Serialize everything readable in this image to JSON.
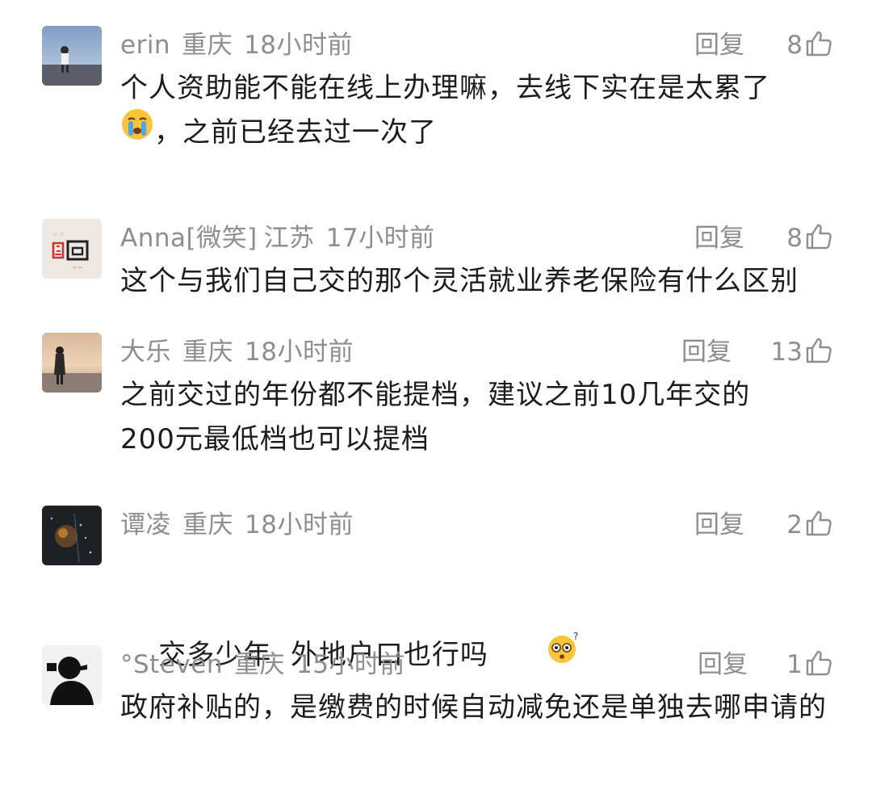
{
  "comments": [
    {
      "username": "erin",
      "location": "重庆",
      "time": "18小时前",
      "reply": "回复",
      "likes": "8",
      "text_a": "个人资助能不能在线上办理嘛，去线下实在是太累了",
      "text_b": "，之前已经去过一次了",
      "emoji": "crying-face"
    },
    {
      "username": "Anna[微笑]",
      "location": "江苏",
      "time": "17小时前",
      "reply": "回复",
      "likes": "8",
      "text": "这个与我们自己交的那个灵活就业养老保险有什么区别"
    },
    {
      "username": "大乐",
      "location": "重庆",
      "time": "18小时前",
      "reply": "回复",
      "likes": "13",
      "text_line1": "之前交过的年份都不能提档，建议之前10几年交的",
      "text_line2": "200元最低档也可以提档"
    },
    {
      "username": "谭凌",
      "location": "重庆",
      "time": "18小时前",
      "reply": "回复",
      "likes": "2",
      "text": "交多少年  外地户口也行吗",
      "emoji": "confused-face"
    },
    {
      "username": "°Steven",
      "location": "重庆",
      "time": "15小时前",
      "reply": "回复",
      "likes": "1",
      "text": "政府补贴的，是缴费的时候自动减免还是单独去哪申请的"
    }
  ],
  "icons": {
    "like": "thumbs-up-outline-icon"
  },
  "colors": {
    "meta": "#8e8e8e",
    "text": "#1c1c1c",
    "background": "#ffffff"
  }
}
